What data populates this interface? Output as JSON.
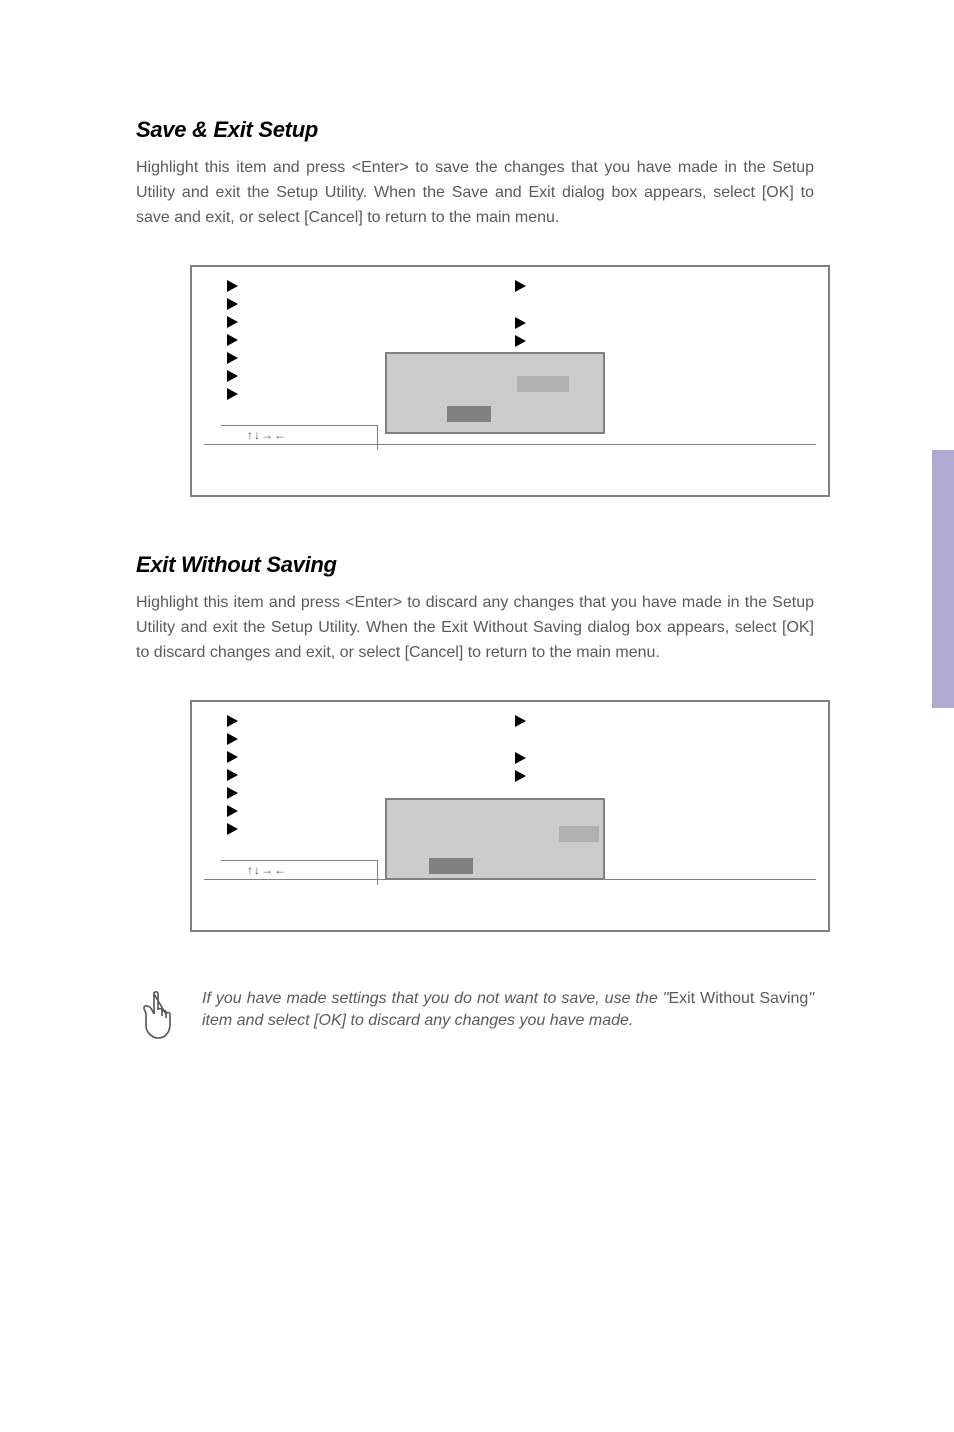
{
  "section1": {
    "heading": "Save & Exit Setup",
    "body": "Highlight this item and press <Enter> to save the changes that you have made in the Setup Utility and exit the Setup Utility. When the Save and Exit dialog box appears, select [OK] to save and exit, or select [Cancel] to return to the main menu."
  },
  "section2": {
    "heading": "Exit Without Saving",
    "body": "Highlight this item and press <Enter> to discard any changes that you have made in the Setup Utility and exit the Setup Utility. When the Exit Without Saving dialog box appears, select [OK] to discard changes and exit, or select [Cancel] to return to the main menu."
  },
  "bios": {
    "hint_arrows": "↑↓→←"
  },
  "note": {
    "part1": "If you have made settings that you do not want to save, use the \"",
    "nonitalic": "Exit Without Saving",
    "part2": "\" item and select [OK] to discard any changes you have made."
  }
}
